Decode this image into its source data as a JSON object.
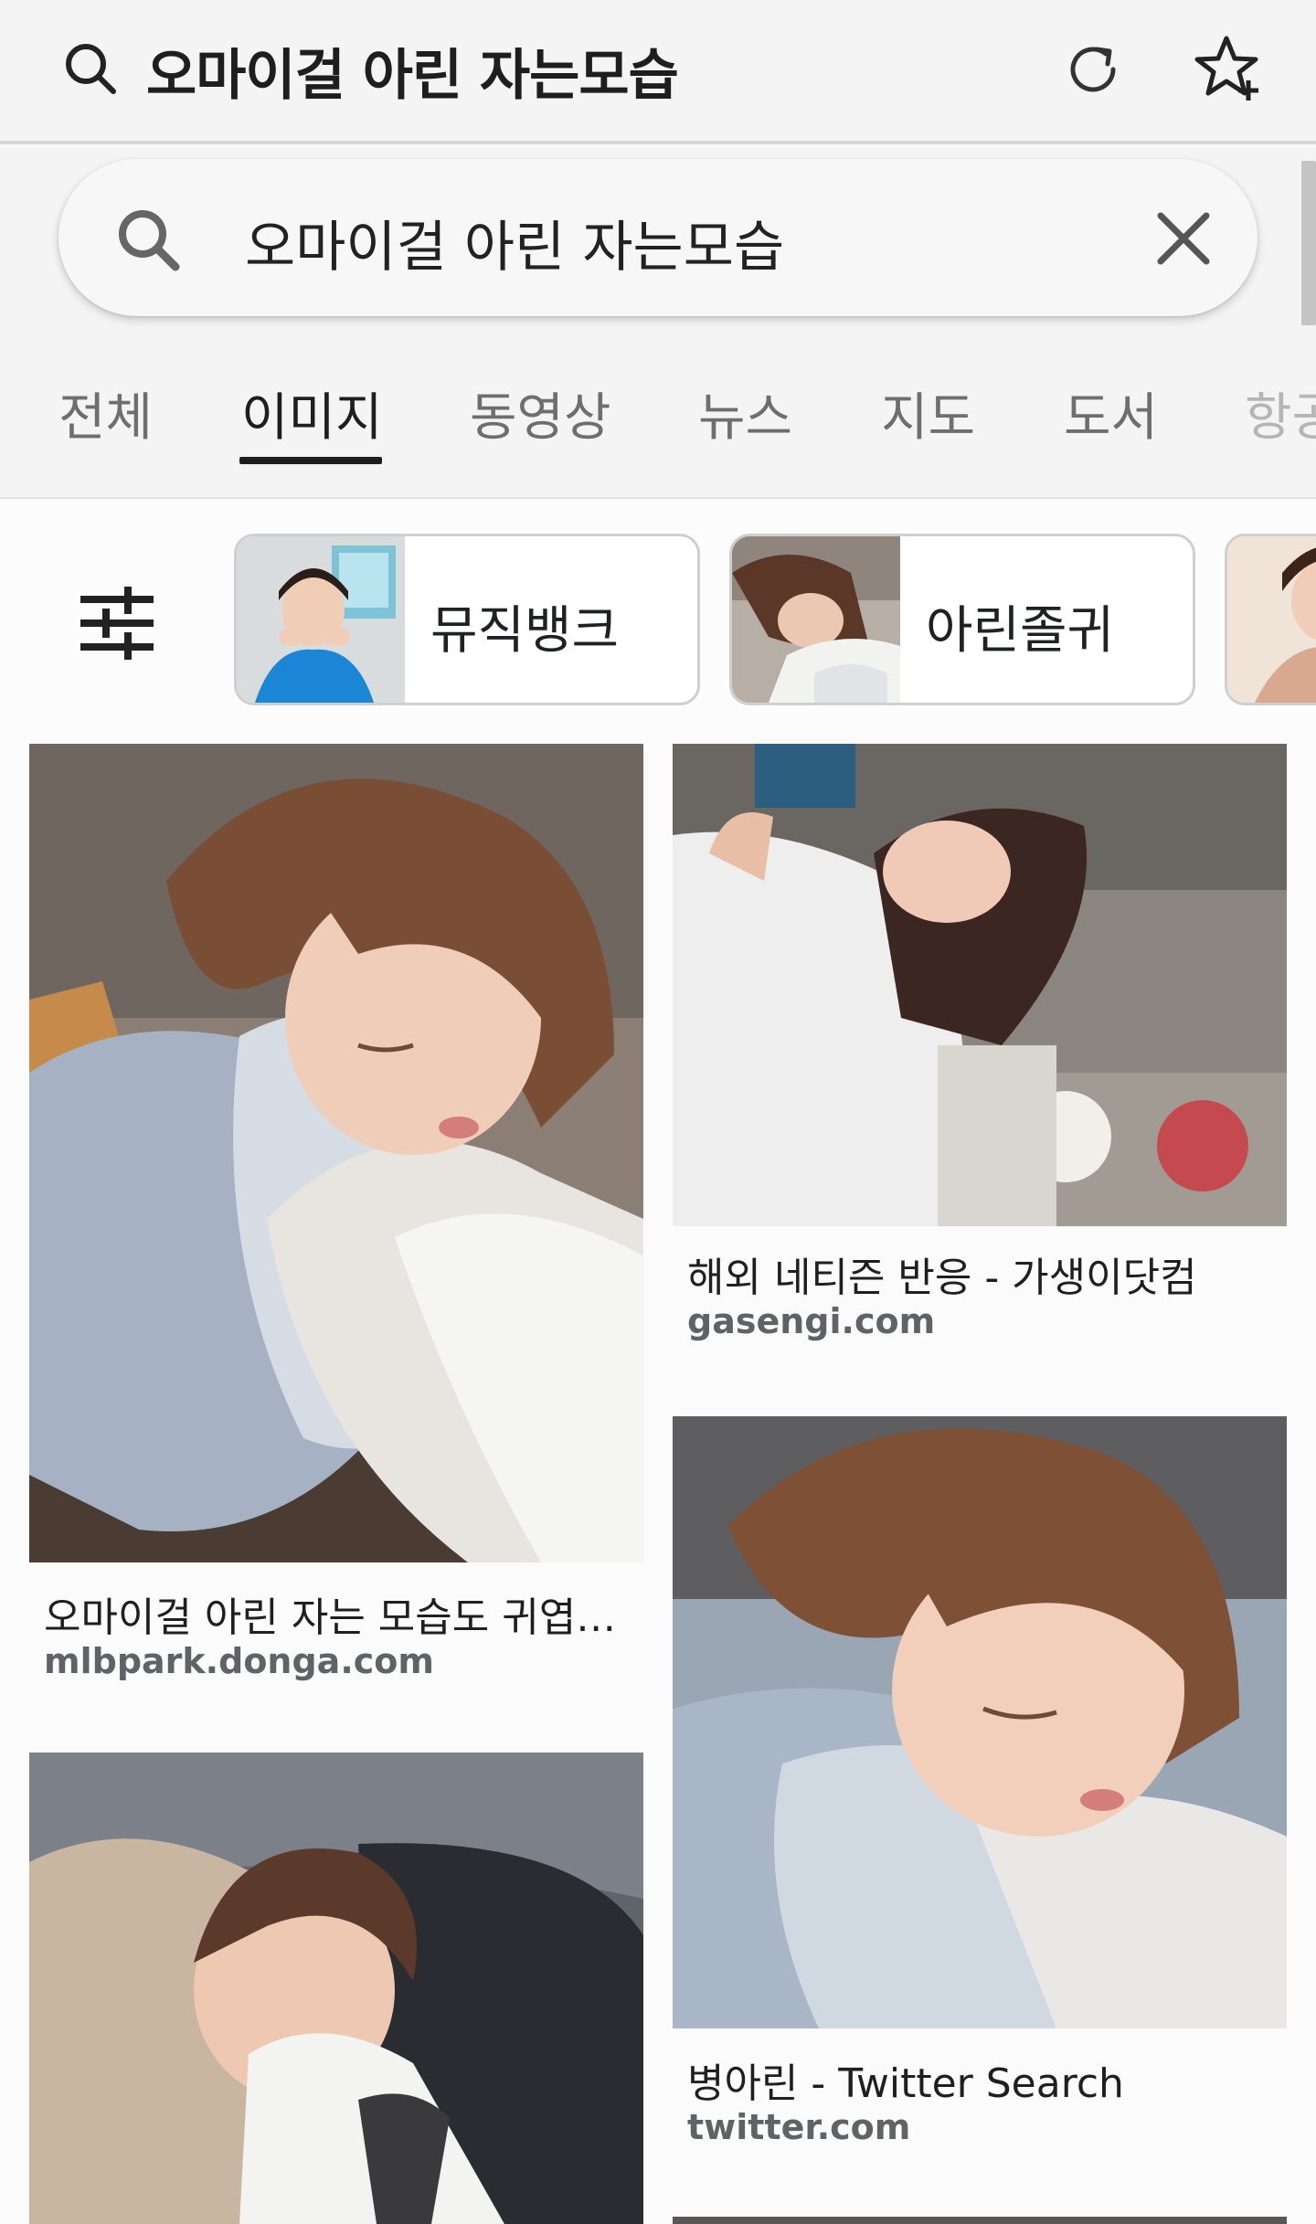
{
  "topbar": {
    "title": "오마이걸 아린 자는모습"
  },
  "search": {
    "query": "오마이걸 아린 자는모습"
  },
  "tabs": [
    {
      "label": "전체"
    },
    {
      "label": "이미지"
    },
    {
      "label": "동영상"
    },
    {
      "label": "뉴스"
    },
    {
      "label": "지도"
    },
    {
      "label": "도서"
    },
    {
      "label": "항공"
    }
  ],
  "active_tab": "이미지",
  "chips": [
    {
      "label": "뮤직뱅크"
    },
    {
      "label": "아린졸귀"
    }
  ],
  "results": [
    {
      "title": "오마이걸 아린 자는 모습도 귀엽…",
      "source": "mlbpark.donga.com"
    },
    {
      "title": "해외 네티즌 반응 - 가생이닷컴",
      "source": "gasengi.com"
    },
    {
      "title": "병아린 - Twitter Search",
      "source": "twitter.com"
    }
  ]
}
